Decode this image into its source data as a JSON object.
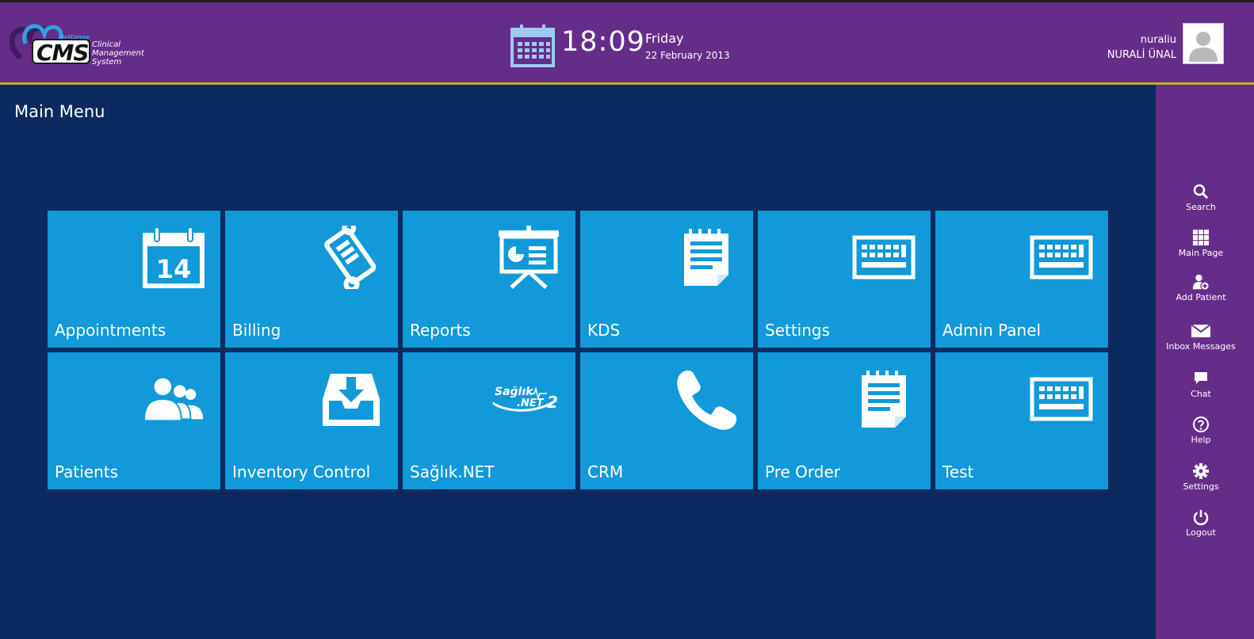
{
  "header": {
    "logo": {
      "brand": "AviCenna",
      "text": "CMS",
      "subtitle_lines": [
        "Clinical",
        "Management",
        "System"
      ]
    },
    "clock": {
      "time": "18:09",
      "day": "Friday",
      "date": "22 February 2013"
    },
    "user": {
      "username": "nuraliu",
      "full_name": "NURALİ ÜNAL"
    }
  },
  "main": {
    "title": "Main Menu",
    "tiles": [
      {
        "label": "Appointments",
        "icon": "calendar-icon",
        "icon_text": "14"
      },
      {
        "label": "Billing",
        "icon": "scroll-icon"
      },
      {
        "label": "Reports",
        "icon": "presentation-icon"
      },
      {
        "label": "KDS",
        "icon": "notepad-icon"
      },
      {
        "label": "Settings",
        "icon": "keyboard-icon"
      },
      {
        "label": "Admin Panel",
        "icon": "keyboard-icon"
      },
      {
        "label": "Patients",
        "icon": "users-icon"
      },
      {
        "label": "Inventory Control",
        "icon": "inbox-icon"
      },
      {
        "label": "Sağlık.NET",
        "icon": "saglik-net-logo",
        "icon_text": "Sağlık .NET 2"
      },
      {
        "label": "CRM",
        "icon": "phone-icon"
      },
      {
        "label": "Pre Order",
        "icon": "notepad-icon"
      },
      {
        "label": "Test",
        "icon": "keyboard-icon"
      }
    ]
  },
  "sidebar": {
    "items": [
      {
        "label": "Search",
        "icon": "search-icon"
      },
      {
        "label": "Main Page",
        "icon": "grid-icon"
      },
      {
        "label": "Add Patient",
        "icon": "add-user-icon"
      },
      {
        "label": "Inbox Messages",
        "icon": "envelope-icon"
      },
      {
        "label": "Chat",
        "icon": "chat-icon"
      },
      {
        "label": "Help",
        "icon": "help-icon"
      },
      {
        "label": "Settings",
        "icon": "gear-icon"
      },
      {
        "label": "Logout",
        "icon": "power-icon"
      }
    ]
  },
  "colors": {
    "header": "#652d8a",
    "background": "#0c2a60",
    "tile": "#1199d9",
    "accent_line": "#b9b22a"
  }
}
